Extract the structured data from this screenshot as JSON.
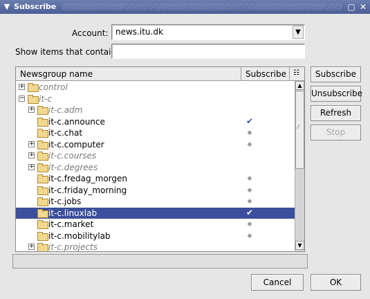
{
  "window": {
    "title": "Subscribe",
    "menu_icon": "▼",
    "maximize_icon": "▢",
    "close_icon": "✕"
  },
  "account": {
    "label": "Account:",
    "value": "news.itu.dk"
  },
  "filter": {
    "label": "Show items that contain:",
    "value": ""
  },
  "list": {
    "header_name": "Newsgroup name",
    "header_subscribe": "Subscribe",
    "items": [
      {
        "name": "control",
        "italic": true,
        "depth": 0,
        "expander": "+",
        "mark": ""
      },
      {
        "name": "it-c",
        "italic": true,
        "depth": 0,
        "expander": "−",
        "mark": ""
      },
      {
        "name": "it-c.adm",
        "italic": true,
        "depth": 1,
        "expander": "+",
        "mark": ""
      },
      {
        "name": "it-c.announce",
        "italic": false,
        "depth": 1,
        "expander": "",
        "mark": "check"
      },
      {
        "name": "it-c.chat",
        "italic": false,
        "depth": 1,
        "expander": "",
        "mark": "dot"
      },
      {
        "name": "it-c.computer",
        "italic": false,
        "depth": 1,
        "expander": "+",
        "mark": "dot"
      },
      {
        "name": "it-c.courses",
        "italic": true,
        "depth": 1,
        "expander": "+",
        "mark": ""
      },
      {
        "name": "it-c.degrees",
        "italic": true,
        "depth": 1,
        "expander": "+",
        "mark": ""
      },
      {
        "name": "it-c.fredag_morgen",
        "italic": false,
        "depth": 1,
        "expander": "",
        "mark": "dot"
      },
      {
        "name": "it-c.friday_morning",
        "italic": false,
        "depth": 1,
        "expander": "",
        "mark": "dot"
      },
      {
        "name": "it-c.jobs",
        "italic": false,
        "depth": 1,
        "expander": "",
        "mark": "dot"
      },
      {
        "name": "it-c.linuxlab",
        "italic": false,
        "depth": 1,
        "expander": "",
        "mark": "check",
        "selected": true
      },
      {
        "name": "it-c.market",
        "italic": false,
        "depth": 1,
        "expander": "",
        "mark": "dot"
      },
      {
        "name": "it-c.mobilitylab",
        "italic": false,
        "depth": 1,
        "expander": "",
        "mark": "dot"
      },
      {
        "name": "it-c.projects",
        "italic": true,
        "depth": 1,
        "expander": "+",
        "mark": ""
      }
    ]
  },
  "buttons": {
    "subscribe": "Subscribe",
    "unsubscribe": "Unsubscribe",
    "refresh": "Refresh",
    "stop": "Stop",
    "cancel": "Cancel",
    "ok": "OK"
  }
}
